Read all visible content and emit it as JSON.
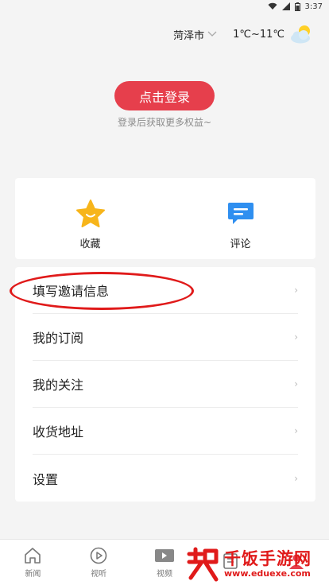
{
  "status": {
    "time": "3:37"
  },
  "header": {
    "city": "菏泽市",
    "temperature": "1℃~11℃"
  },
  "login": {
    "button_label": "点击登录",
    "hint": "登录后获取更多权益~"
  },
  "quick_actions": [
    {
      "label": "收藏",
      "icon": "star-icon",
      "color": "#f7b51b"
    },
    {
      "label": "评论",
      "icon": "comment-icon",
      "color": "#2f8ff0"
    }
  ],
  "menu": [
    {
      "label": "填写邀请信息"
    },
    {
      "label": "我的订阅"
    },
    {
      "label": "我的关注"
    },
    {
      "label": "收货地址"
    },
    {
      "label": "设置"
    }
  ],
  "tabs": [
    {
      "label": "新闻",
      "icon": "home-icon"
    },
    {
      "label": "视听",
      "icon": "play-icon"
    },
    {
      "label": "视频",
      "icon": "video-icon"
    },
    {
      "label": "",
      "icon": "apps-icon"
    },
    {
      "label": "",
      "icon": "user-icon"
    }
  ],
  "watermark": {
    "title": "千饭手游网",
    "url": "www.eduexe.com"
  },
  "colors": {
    "accent": "#e63f4c",
    "annotation": "#e01a1a"
  }
}
